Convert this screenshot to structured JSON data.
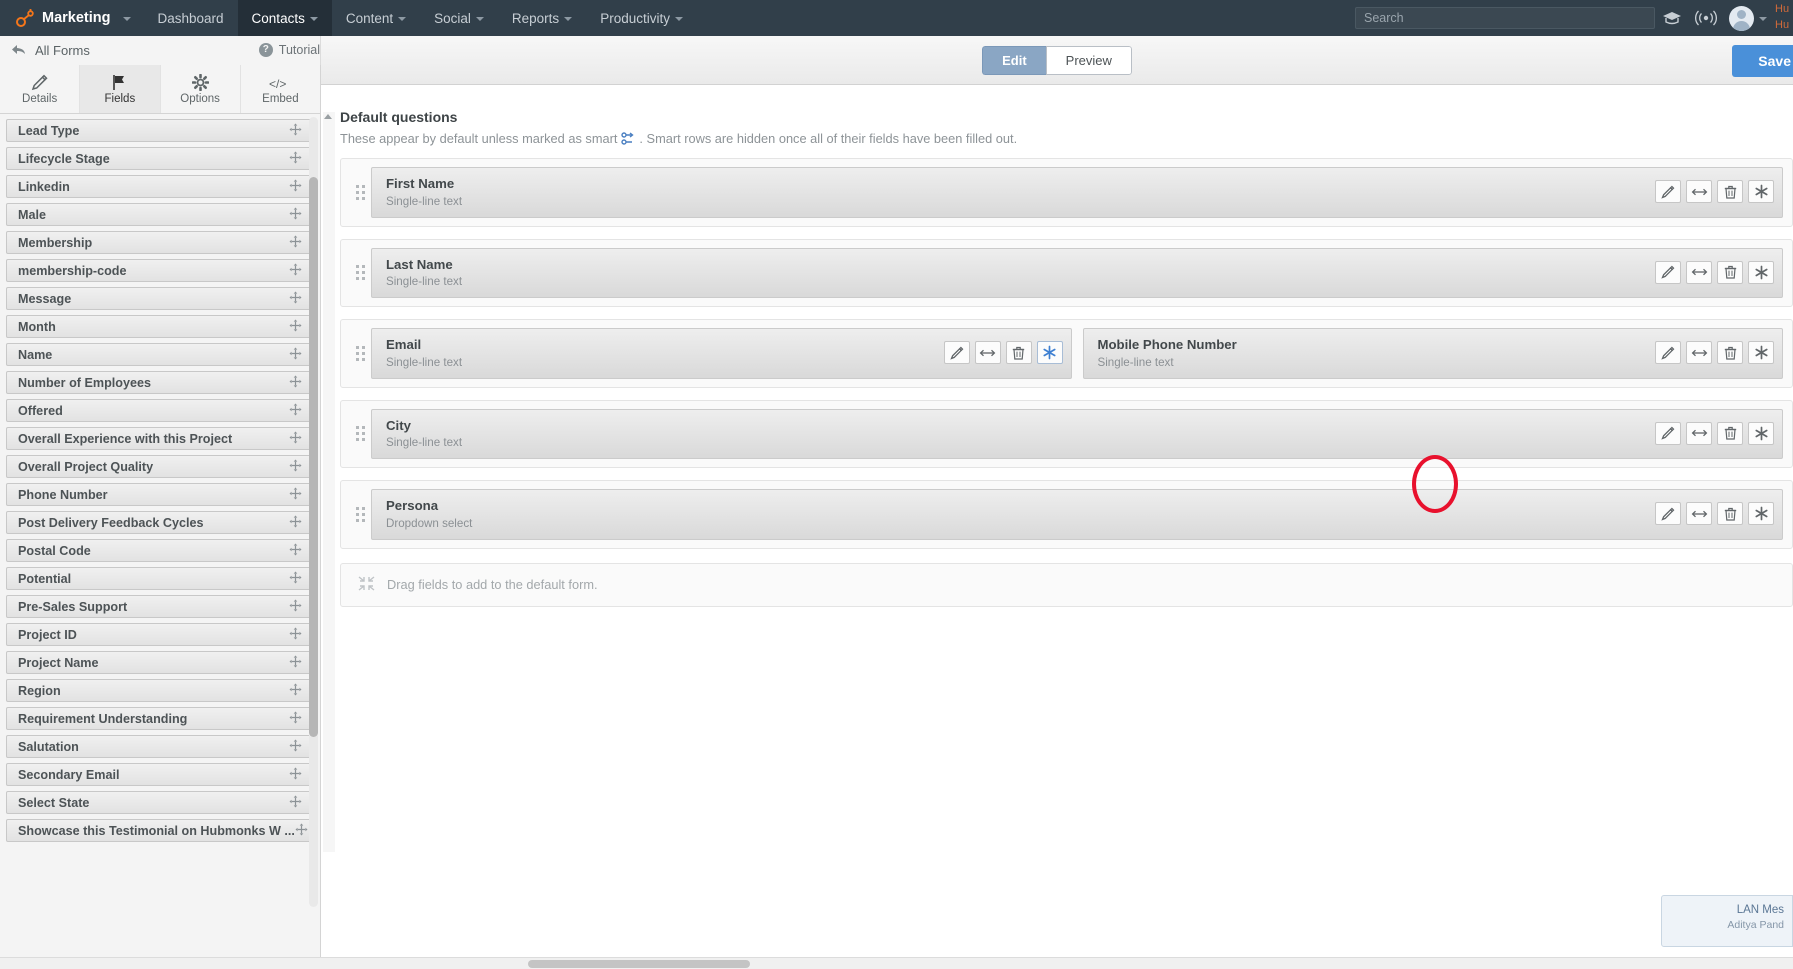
{
  "topnav": {
    "brand": "Marketing",
    "items": [
      {
        "label": "Dashboard",
        "has_caret": false,
        "active": false
      },
      {
        "label": "Contacts",
        "has_caret": true,
        "active": true
      },
      {
        "label": "Content",
        "has_caret": true,
        "active": false
      },
      {
        "label": "Social",
        "has_caret": true,
        "active": false
      },
      {
        "label": "Reports",
        "has_caret": true,
        "active": false
      },
      {
        "label": "Productivity",
        "has_caret": true,
        "active": false
      }
    ],
    "search_placeholder": "Search",
    "search_value": "",
    "icons": [
      "academy-cap-icon",
      "broadcast-icon",
      "avatar"
    ],
    "account_line1": "Hu",
    "account_line2": "Hu"
  },
  "subheader": {
    "back_label": "All Forms",
    "tutorial_label": "Tutorial",
    "help_badge": "?"
  },
  "toolbar": {
    "edit_label": "Edit",
    "preview_label": "Preview",
    "save_label": "Save"
  },
  "sidebar": {
    "tabs": [
      {
        "label": "Details",
        "icon": "pencil-icon",
        "active": false
      },
      {
        "label": "Fields",
        "icon": "flag-icon",
        "active": true
      },
      {
        "label": "Options",
        "icon": "gear-icon",
        "active": false
      },
      {
        "label": "Embed",
        "icon": "code-icon",
        "active": false
      }
    ],
    "fields": [
      "Lead Type",
      "Lifecycle Stage",
      "Linkedin",
      "Male",
      "Membership",
      "membership-code",
      "Message",
      "Month",
      "Name",
      "Number of Employees",
      "Offered",
      "Overall Experience with this Project",
      "Overall Project Quality",
      "Phone Number",
      "Post Delivery Feedback Cycles",
      "Postal Code",
      "Potential",
      "Pre-Sales Support",
      "Project ID",
      "Project Name",
      "Region",
      "Requirement Understanding",
      "Salutation",
      "Secondary Email",
      "Select State",
      "Showcase this Testimonial on Hubmonks W ..."
    ]
  },
  "main": {
    "section_title": "Default questions",
    "section_sub_before": "These appear by default unless marked as smart",
    "section_sub_after": ". Smart rows are hidden once all of their fields have been filled out.",
    "rows": [
      {
        "fields": [
          {
            "label": "First Name",
            "type": "Single-line text",
            "smart_active": false
          }
        ]
      },
      {
        "fields": [
          {
            "label": "Last Name",
            "type": "Single-line text",
            "smart_active": false
          }
        ]
      },
      {
        "fields": [
          {
            "label": "Email",
            "type": "Single-line text",
            "smart_active": true
          },
          {
            "label": "Mobile Phone Number",
            "type": "Single-line text",
            "smart_active": false
          }
        ]
      },
      {
        "fields": [
          {
            "label": "City",
            "type": "Single-line text",
            "smart_active": false
          }
        ]
      },
      {
        "fields": [
          {
            "label": "Persona",
            "type": "Dropdown select",
            "smart_active": false
          }
        ]
      }
    ],
    "dropzone_label": "Drag fields to add to the default form.",
    "row_actions": [
      "edit-pencil-icon",
      "resize-arrows-icon",
      "delete-trash-icon",
      "smart-star-icon"
    ]
  },
  "widget": {
    "title": "LAN Mes",
    "sub": "Aditya Pand"
  },
  "colors": {
    "accent_blue": "#4a90d9",
    "toggle_active": "#8aa6c4",
    "smart_blue": "#3d7fd1",
    "annotation_red": "#e8112d",
    "nav_bg": "#313f4a",
    "brand_orange": "#f5761a"
  }
}
